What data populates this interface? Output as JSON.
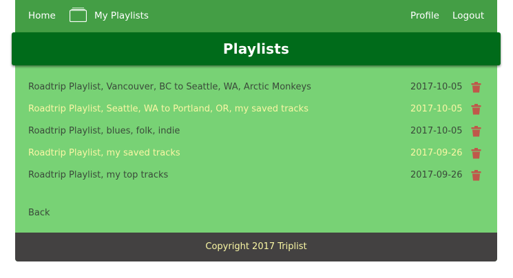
{
  "nav": {
    "home": "Home",
    "my_playlists": "My Playlists",
    "profile": "Profile",
    "logout": "Logout",
    "playlist_icon": "playlist-stack-icon"
  },
  "page_title": "Playlists",
  "playlists": [
    {
      "name": "Roadtrip Playlist, Vancouver, BC to Seattle, WA, Arctic Monkeys",
      "date": "2017-10-05",
      "highlighted": false
    },
    {
      "name": "Roadtrip Playlist, Seattle, WA to Portland, OR, my saved tracks",
      "date": "2017-10-05",
      "highlighted": true
    },
    {
      "name": "Roadtrip Playlist, blues, folk, indie",
      "date": "2017-10-05",
      "highlighted": false
    },
    {
      "name": "Roadtrip Playlist, my saved tracks",
      "date": "2017-09-26",
      "highlighted": true
    },
    {
      "name": "Roadtrip Playlist, my top tracks",
      "date": "2017-09-26",
      "highlighted": false
    }
  ],
  "delete_icon": "trash-icon",
  "back": "Back",
  "footer": "Copyright 2017 Triplist",
  "colors": {
    "navbar": "#449e45",
    "title_bar": "#006b1a",
    "content_bg": "#78d275",
    "footer_bg": "#434141",
    "highlight_text": "#f9f6a4",
    "normal_text": "#3a4a3a",
    "trash": "#c0574a"
  }
}
